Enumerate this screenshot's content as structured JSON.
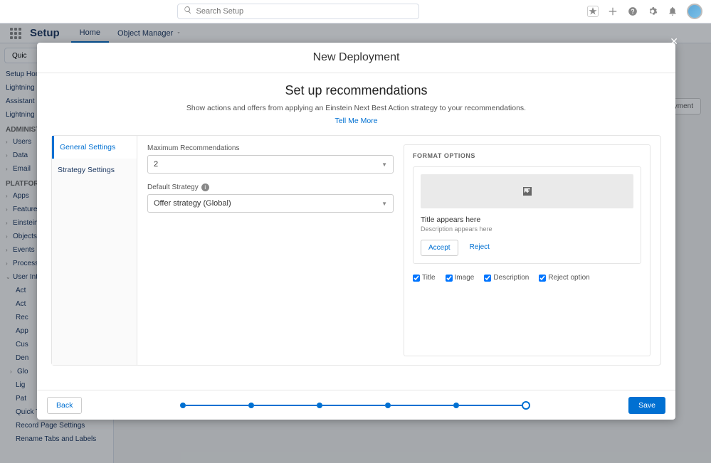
{
  "topbar": {
    "search_placeholder": "Search Setup"
  },
  "nav": {
    "setup": "Setup",
    "tab_home": "Home",
    "tab_object_manager": "Object Manager"
  },
  "sidebar": {
    "quick_find": "Quic",
    "setup_home": "Setup Hom",
    "lightning_exp": "Lightning E",
    "assistant": "Assistant",
    "lightning_u": "Lightning U",
    "admin_head": "ADMINIST",
    "users": "Users",
    "data": "Data",
    "email": "Email",
    "platform_head": "PLATFORM",
    "apps": "Apps",
    "feature": "Feature",
    "einstein": "Einstein",
    "objects": "Objects",
    "events": "Events",
    "process": "Process",
    "user_int": "User Int",
    "act1": "Act",
    "act2": "Act",
    "rec": "Rec",
    "app": "App",
    "cus": "Cus",
    "den": "Den",
    "glo": "Glo",
    "lig": "Lig",
    "pat": "Pat",
    "quick_text": "Quick Text Settings",
    "record_page": "Record Page Settings",
    "rename": "Rename Tabs and Labels"
  },
  "bg_button": "yment",
  "modal": {
    "title": "New Deployment",
    "heading": "Set up recommendations",
    "desc": "Show actions and offers from applying an Einstein Next Best Action strategy to your recommendations.",
    "tell_more": "Tell Me More",
    "leftnav": {
      "general": "General Settings",
      "strategy": "Strategy Settings"
    },
    "form": {
      "max_rec_label": "Maximum Recommendations",
      "max_rec_value": "2",
      "default_strategy_label": "Default Strategy",
      "default_strategy_value": "Offer strategy (Global)"
    },
    "format": {
      "heading": "Format Options",
      "preview_title": "Title appears here",
      "preview_desc": "Description appears here",
      "accept": "Accept",
      "reject": "Reject",
      "chk_title": "Title",
      "chk_image": "Image",
      "chk_description": "Description",
      "chk_reject": "Reject option"
    },
    "footer": {
      "back": "Back",
      "save": "Save"
    }
  }
}
